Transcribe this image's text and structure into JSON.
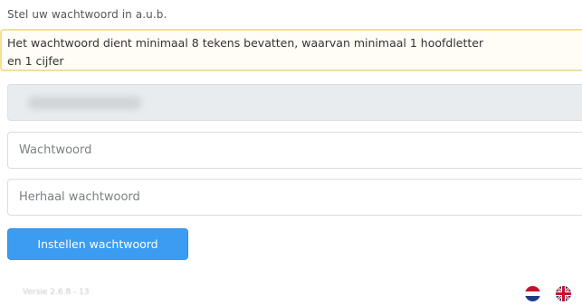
{
  "form": {
    "intro": "Stel uw wachtwoord in a.u.b.",
    "alert": {
      "line1": "Het wachtwoord dient minimaal 8 tekens bevatten, waarvan minimaal 1 hoofdletter",
      "line2": "en 1 cijfer"
    },
    "password_placeholder": "Wachtwoord",
    "password_repeat_placeholder": "Herhaal wachtwoord",
    "submit_label": "Instellen wachtwoord"
  },
  "footer": {
    "version": "Versie 2.6.8 - 13",
    "languages": [
      {
        "code": "nl",
        "icon": "dutch-flag-icon"
      },
      {
        "code": "en",
        "icon": "english-flag-icon"
      }
    ]
  },
  "colors": {
    "primary_button": "#3b9cf2",
    "alert_border": "#f5df98",
    "disabled_field": "#e9ecef"
  }
}
